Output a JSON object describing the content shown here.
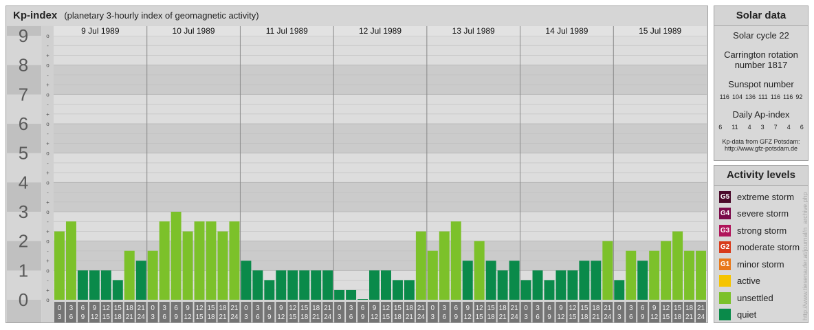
{
  "header": {
    "title": "Kp-index",
    "subtitle": "(planetary 3-hourly index of geomagnetic activity)"
  },
  "chart_data": {
    "type": "bar",
    "title": "Kp-index",
    "ylim": [
      0,
      9
    ],
    "y_ticks": [
      "0",
      "1",
      "2",
      "3",
      "4",
      "5",
      "6",
      "7",
      "8",
      "9"
    ],
    "sub_ticks": [
      "o",
      "+",
      "-"
    ],
    "days": [
      "9 Jul 1989",
      "10 Jul 1989",
      "11 Jul 1989",
      "12 Jul 1989",
      "13 Jul 1989",
      "14 Jul 1989",
      "15 Jul 1989"
    ],
    "interval_labels": [
      [
        "0",
        "3"
      ],
      [
        "3",
        "6"
      ],
      [
        "6",
        "9"
      ],
      [
        "9",
        "12"
      ],
      [
        "12",
        "15"
      ],
      [
        "15",
        "18"
      ],
      [
        "18",
        "21"
      ],
      [
        "21",
        "24"
      ]
    ],
    "values": [
      [
        2.33,
        2.67,
        1.0,
        1.0,
        1.0,
        0.67,
        1.67,
        1.33
      ],
      [
        1.67,
        2.67,
        3.0,
        2.33,
        2.67,
        2.67,
        2.33,
        2.67
      ],
      [
        1.33,
        1.0,
        0.67,
        1.0,
        1.0,
        1.0,
        1.0,
        1.0
      ],
      [
        0.33,
        0.33,
        0.0,
        1.0,
        1.0,
        0.67,
        0.67,
        2.33
      ],
      [
        1.67,
        2.33,
        2.67,
        1.33,
        2.0,
        1.33,
        1.0,
        1.33
      ],
      [
        0.67,
        1.0,
        0.67,
        1.0,
        1.0,
        1.33,
        1.33,
        2.0
      ],
      [
        0.67,
        1.67,
        1.33,
        1.67,
        2.0,
        2.33,
        1.67,
        1.67
      ]
    ],
    "colors": {
      "quiet": "#0a8a4a",
      "unsettled": "#7cc12a"
    }
  },
  "solar": {
    "title": "Solar data",
    "cycle": "Solar cycle 22",
    "carrington1": "Carrington rotation",
    "carrington2": "number 1817",
    "sunspot_label": "Sunspot number",
    "sunspots": [
      "116",
      "104",
      "136",
      "111",
      "116",
      "116",
      "92"
    ],
    "ap_label": "Daily Ap-index",
    "ap": [
      "6",
      "11",
      "4",
      "3",
      "7",
      "4",
      "6"
    ],
    "source1": "Kp-data from GFZ Potsdam:",
    "source2": "http://www.gfz-potsdam.de"
  },
  "levels": {
    "title": "Activity levels",
    "items": [
      {
        "badge": "G5",
        "label": "extreme storm",
        "color": "#4a0a2a"
      },
      {
        "badge": "G4",
        "label": "severe storm",
        "color": "#7a0a4a"
      },
      {
        "badge": "G3",
        "label": "strong storm",
        "color": "#b0145a"
      },
      {
        "badge": "G2",
        "label": "moderate storm",
        "color": "#d83a1a"
      },
      {
        "badge": "G1",
        "label": "minor storm",
        "color": "#e8781a"
      },
      {
        "badge": "",
        "label": "active",
        "color": "#f5c400"
      },
      {
        "badge": "",
        "label": "unsettled",
        "color": "#7cc12a"
      },
      {
        "badge": "",
        "label": "quiet",
        "color": "#0a8a4a"
      }
    ]
  },
  "side_credit": "http://www.tiesenaufer.at/journal/n_archive.php"
}
